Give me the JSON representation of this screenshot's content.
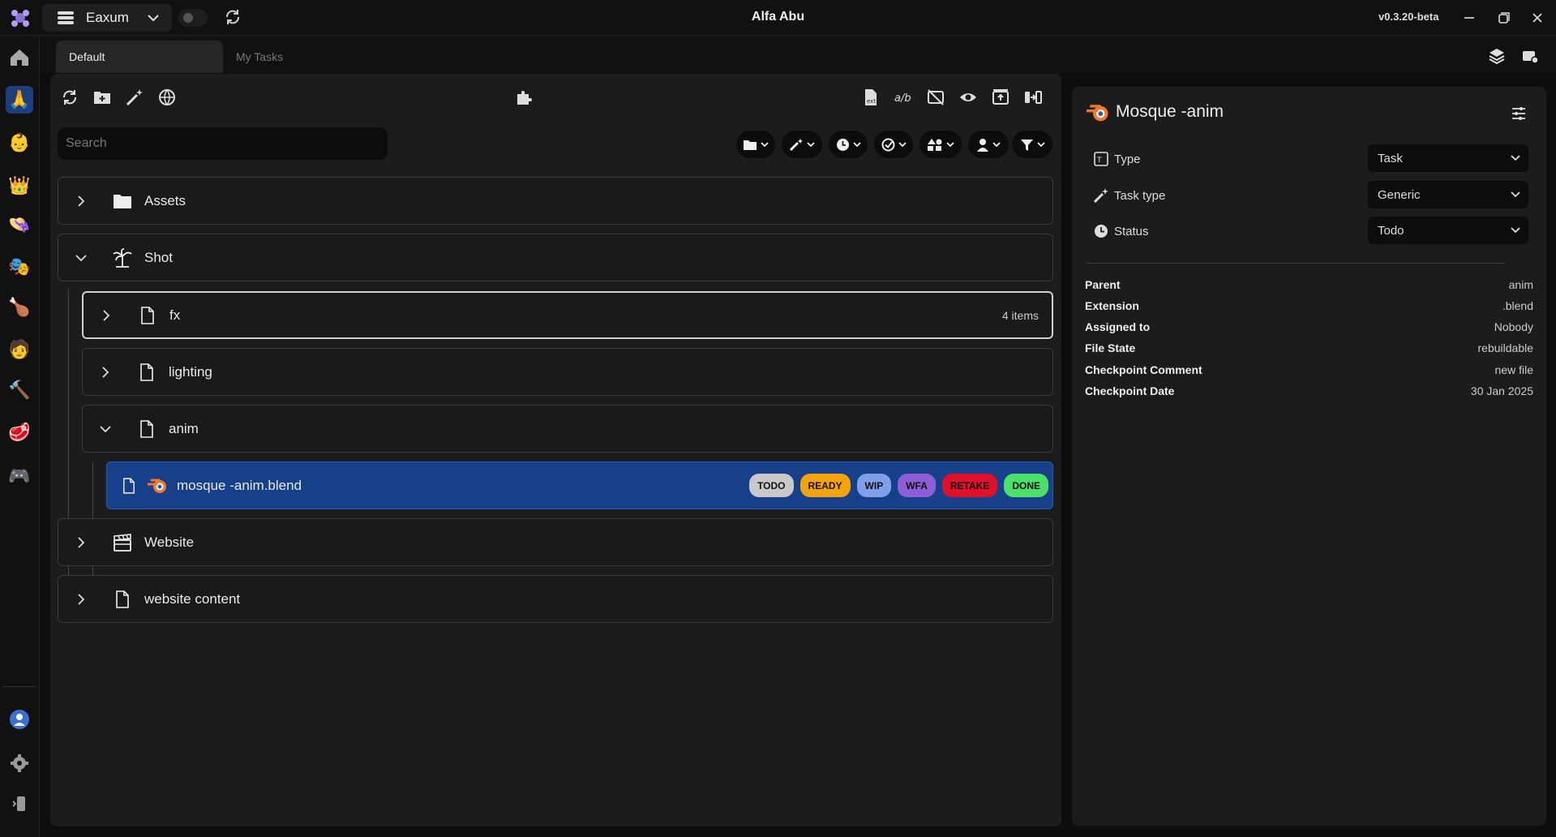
{
  "titlebar": {
    "workspace": "Eaxum",
    "title": "Alfa Abu",
    "version": "v0.3.20-beta"
  },
  "tabs": [
    {
      "label": "Default",
      "active": true
    },
    {
      "label": "My Tasks",
      "active": false
    }
  ],
  "sidebar": {
    "projects": [
      "praying-hands-icon",
      "baby-face-icon",
      "crown-icon",
      "hat-icon",
      "theater-masks-icon",
      "meat-icon",
      "person-face-icon",
      "hammer-icon",
      "steak-icon",
      "gamepad-icon"
    ]
  },
  "search": {
    "placeholder": "Search"
  },
  "tree": {
    "assets": {
      "label": "Assets"
    },
    "shot": {
      "label": "Shot"
    },
    "fx": {
      "label": "fx",
      "count": "4 items"
    },
    "lighting": {
      "label": "lighting"
    },
    "anim": {
      "label": "anim"
    },
    "file": {
      "label": "mosque -anim.blend"
    },
    "website": {
      "label": "Website"
    },
    "website_content": {
      "label": "website content"
    }
  },
  "statuses": [
    {
      "label": "TODO",
      "color": "#c9c9c9",
      "text": "#111111"
    },
    {
      "label": "READY",
      "color": "#f5a30a",
      "text": "#111111"
    },
    {
      "label": "WIP",
      "color": "#7f9fe8",
      "text": "#111111"
    },
    {
      "label": "WFA",
      "color": "#8e5ed6",
      "text": "#111111"
    },
    {
      "label": "RETAKE",
      "color": "#e0102a",
      "text": "#111111"
    },
    {
      "label": "DONE",
      "color": "#4be06a",
      "text": "#111111"
    }
  ],
  "details": {
    "title": "Mosque -anim",
    "props": {
      "type_label": "Type",
      "type_value": "Task",
      "task_type_label": "Task type",
      "task_type_value": "Generic",
      "status_label": "Status",
      "status_value": "Todo"
    },
    "info": [
      {
        "key": "Parent",
        "value": "anim"
      },
      {
        "key": "Extension",
        "value": ".blend"
      },
      {
        "key": "Assigned to",
        "value": "Nobody"
      },
      {
        "key": "File State",
        "value": "rebuildable"
      },
      {
        "key": "Checkpoint Comment",
        "value": "new file"
      },
      {
        "key": "Checkpoint Date",
        "value": "30 Jan 2025"
      }
    ]
  }
}
